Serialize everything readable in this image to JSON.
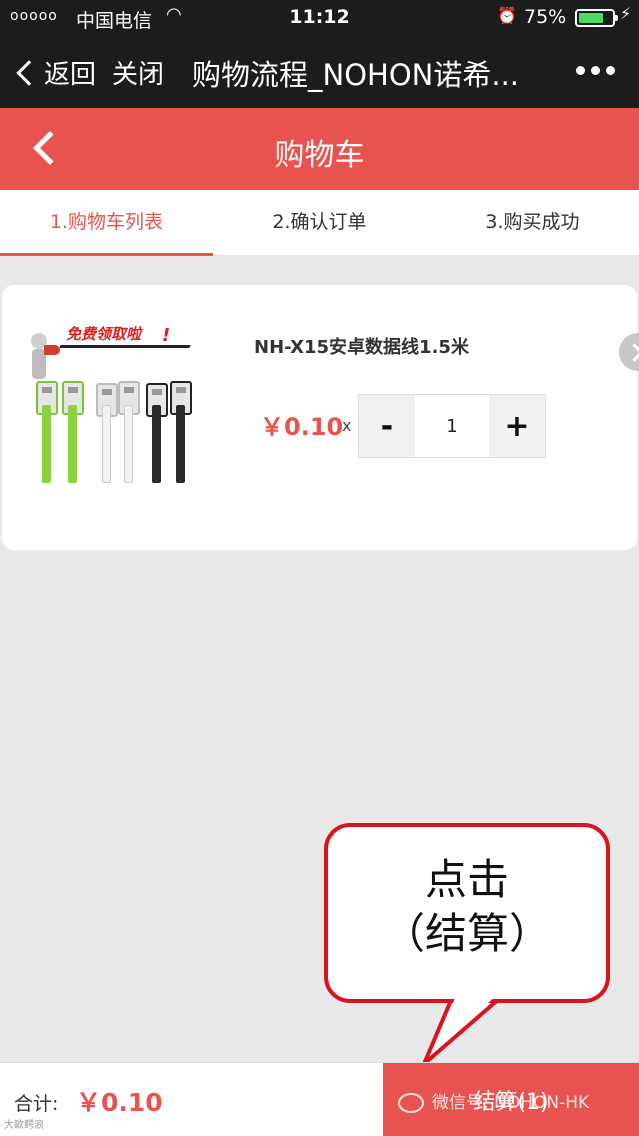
{
  "status_bar": {
    "signal": "ooooo",
    "carrier": "中国电信",
    "time": "11:12",
    "battery_pct": "75%",
    "battery_level": 0.75,
    "battery_color": "#4cd964"
  },
  "wechat_nav": {
    "back_label": "返回",
    "close_label": "关闭",
    "title": "购物流程_NOHON诺希..."
  },
  "header": {
    "title": "购物车",
    "accent_color": "#e9534f"
  },
  "tabs": [
    {
      "label": "1.购物车列表",
      "active": true
    },
    {
      "label": "2.确认订单",
      "active": false
    },
    {
      "label": "3.购买成功",
      "active": false
    }
  ],
  "cart_item": {
    "image_promo_text": "免费领取啦",
    "image_promo_excl": "!",
    "name": "NH-X15安卓数据线1.5米",
    "price": "￥0.10",
    "times": "x",
    "minus": "-",
    "quantity": "1",
    "plus": "+"
  },
  "callout": {
    "line1": "点击",
    "line2": "（结算）"
  },
  "bottom_bar": {
    "total_label": "合计:",
    "total_value": "￥0.10",
    "checkout_label": "结算(1)"
  },
  "watermark": {
    "text": "微信号: NOHON-HK",
    "corner_text": "大歐鳄浪"
  }
}
